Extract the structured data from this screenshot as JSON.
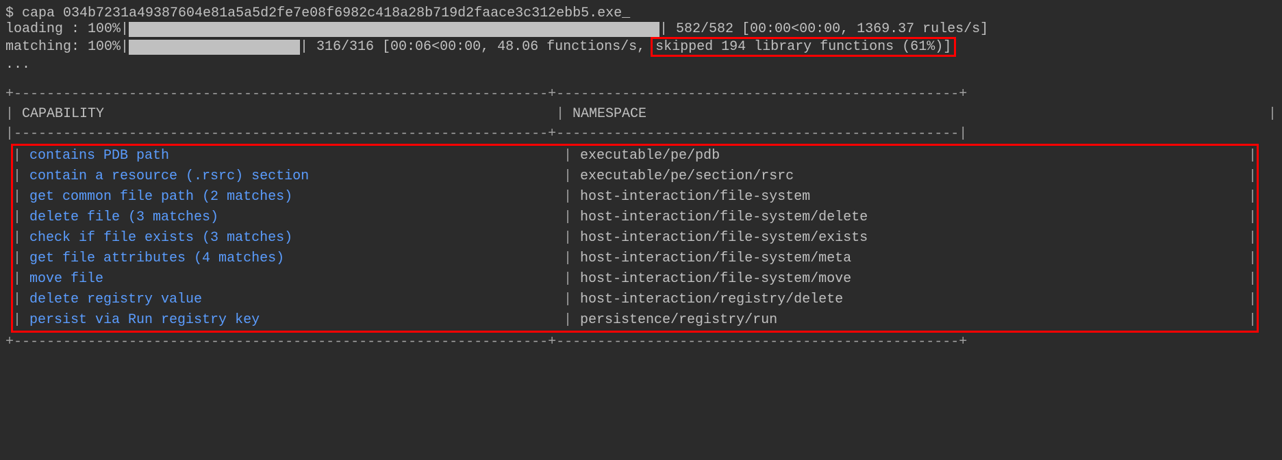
{
  "command": {
    "prompt": "$ ",
    "text": "capa 034b7231a49387604e81a5a5d2fe7e08f6982c418a28b719d2faace3c312ebb5.exe",
    "cursor": "_"
  },
  "loading": {
    "label": "loading : 100%|",
    "stats": "| 582/582 [00:00<00:00, 1369.37 rules/s]"
  },
  "matching": {
    "label": "matching: 100%|",
    "stats_pre": "| 316/316 [00:06<00:00, 48.06 functions/s, ",
    "stats_highlighted": "skipped 194 library functions (61%)]"
  },
  "ellipsis": "...",
  "table": {
    "top_border": "+------------------------------------------------------------+---------------------------------------------+",
    "header_border": "|------------------------------------------------------------+---------------------------------------------|",
    "bottom_border": "+------------------------------------------------------------+---------------------------------------------+",
    "headers": {
      "capability": "CAPABILITY",
      "namespace": "NAMESPACE"
    },
    "rows": [
      {
        "capability": "contains PDB path",
        "namespace": "executable/pe/pdb"
      },
      {
        "capability": "contain a resource (.rsrc) section",
        "namespace": "executable/pe/section/rsrc"
      },
      {
        "capability": "get common file path (2 matches)",
        "namespace": "host-interaction/file-system"
      },
      {
        "capability": "delete file (3 matches)",
        "namespace": "host-interaction/file-system/delete"
      },
      {
        "capability": "check if file exists (3 matches)",
        "namespace": "host-interaction/file-system/exists"
      },
      {
        "capability": "get file attributes (4 matches)",
        "namespace": "host-interaction/file-system/meta"
      },
      {
        "capability": "move file",
        "namespace": "host-interaction/file-system/move"
      },
      {
        "capability": "delete registry value",
        "namespace": "host-interaction/registry/delete"
      },
      {
        "capability": "persist via Run registry key",
        "namespace": "persistence/registry/run"
      }
    ]
  }
}
